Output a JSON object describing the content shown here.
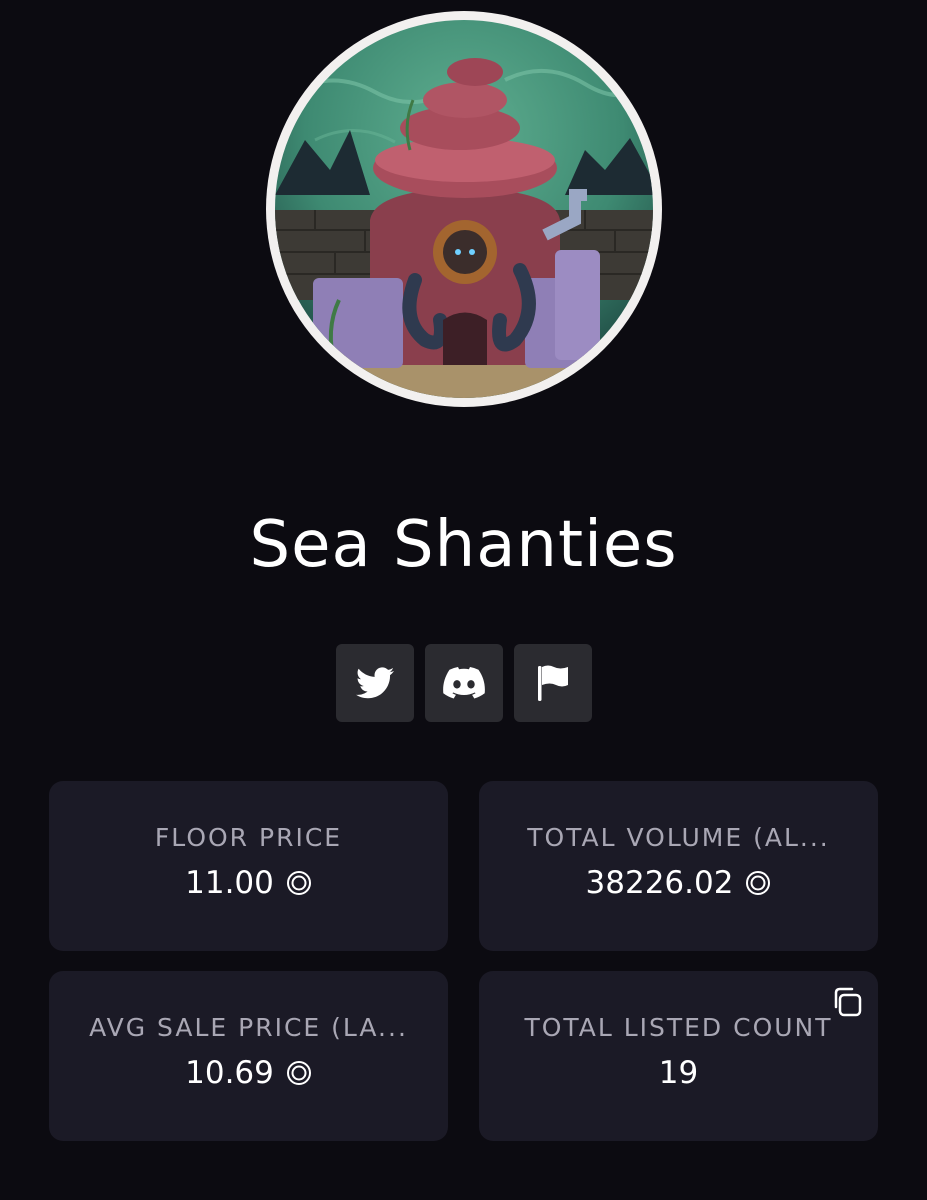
{
  "collection": {
    "name": "Sea Shanties"
  },
  "socials": [
    {
      "icon": "twitter-icon"
    },
    {
      "icon": "discord-icon"
    },
    {
      "icon": "flag-icon"
    }
  ],
  "stats": {
    "floor_price": {
      "label": "FLOOR PRICE",
      "value": "11.00",
      "currency_icon": "sol-icon"
    },
    "total_volume": {
      "label": "TOTAL VOLUME (AL...",
      "value": "38226.02",
      "currency_icon": "sol-icon"
    },
    "avg_sale_price": {
      "label": "AVG SALE PRICE (LA...",
      "value": "10.69",
      "currency_icon": "sol-icon"
    },
    "total_listed_count": {
      "label": "TOTAL LISTED COUNT",
      "value": "19",
      "action_icon": "copy-icon"
    }
  },
  "colors": {
    "background": "#0c0b11",
    "card": "#1b1a26",
    "social_button": "#2b2b30",
    "label": "#a9a7b4",
    "text": "#ffffff"
  }
}
